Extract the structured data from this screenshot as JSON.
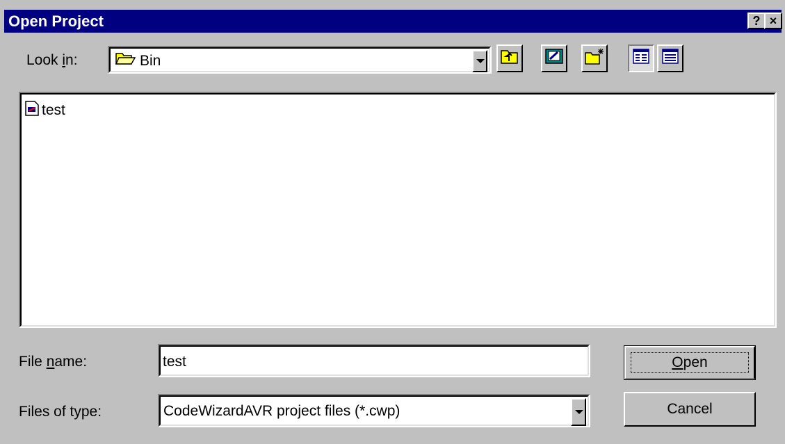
{
  "window": {
    "title": "Open Project",
    "help_glyph": "?",
    "close_glyph": "×"
  },
  "look_in": {
    "label_pre": "Look ",
    "label_key": "i",
    "label_post": "n:",
    "value": "Bin",
    "folder_icon": "folder-icon"
  },
  "toolbar": {
    "buttons": [
      "up-one-level-icon",
      "desktop-icon",
      "new-folder-icon",
      "list-view-icon",
      "details-view-icon"
    ]
  },
  "files": [
    {
      "name": "test",
      "icon": "project-file-icon"
    }
  ],
  "file_name": {
    "label_pre": "File ",
    "label_key": "n",
    "label_post": "ame:",
    "value": "test"
  },
  "file_type": {
    "label": "Files of type:",
    "value": "CodeWizardAVR project files (*.cwp)"
  },
  "buttons": {
    "open_key": "O",
    "open_rest": "pen",
    "cancel": "Cancel"
  },
  "colors": {
    "titlebar": "#000080",
    "face": "#c0c0c0"
  }
}
